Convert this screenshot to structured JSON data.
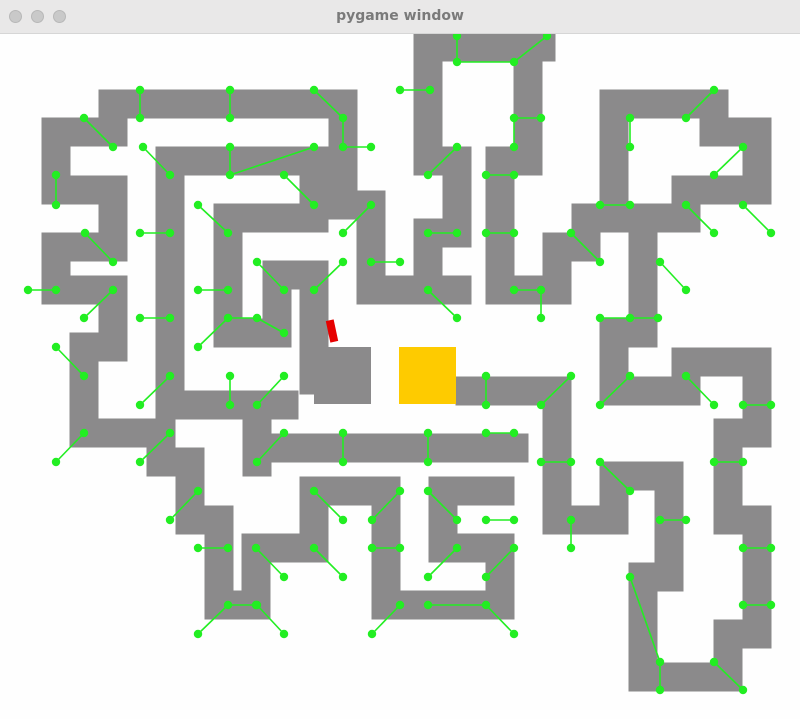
{
  "window": {
    "title": "pygame window"
  },
  "colors": {
    "track": "#8b8a8b",
    "goal": "#fecb00",
    "car": "#e60000",
    "waypoint": "#22ee22",
    "background": "#fefefe"
  },
  "goal": {
    "label": ""
  },
  "car": {
    "label": ""
  }
}
